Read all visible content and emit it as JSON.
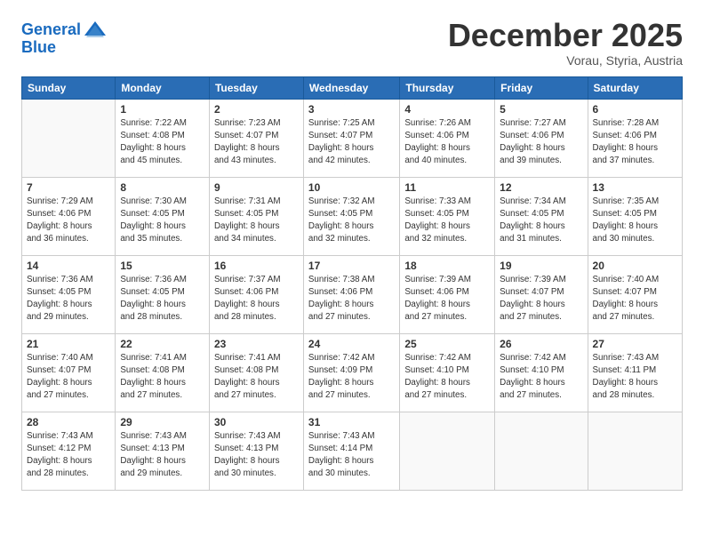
{
  "header": {
    "logo_general": "General",
    "logo_blue": "Blue",
    "month": "December 2025",
    "location": "Vorau, Styria, Austria"
  },
  "days_of_week": [
    "Sunday",
    "Monday",
    "Tuesday",
    "Wednesday",
    "Thursday",
    "Friday",
    "Saturday"
  ],
  "weeks": [
    [
      {
        "day": "",
        "info": ""
      },
      {
        "day": "1",
        "info": "Sunrise: 7:22 AM\nSunset: 4:08 PM\nDaylight: 8 hours\nand 45 minutes."
      },
      {
        "day": "2",
        "info": "Sunrise: 7:23 AM\nSunset: 4:07 PM\nDaylight: 8 hours\nand 43 minutes."
      },
      {
        "day": "3",
        "info": "Sunrise: 7:25 AM\nSunset: 4:07 PM\nDaylight: 8 hours\nand 42 minutes."
      },
      {
        "day": "4",
        "info": "Sunrise: 7:26 AM\nSunset: 4:06 PM\nDaylight: 8 hours\nand 40 minutes."
      },
      {
        "day": "5",
        "info": "Sunrise: 7:27 AM\nSunset: 4:06 PM\nDaylight: 8 hours\nand 39 minutes."
      },
      {
        "day": "6",
        "info": "Sunrise: 7:28 AM\nSunset: 4:06 PM\nDaylight: 8 hours\nand 37 minutes."
      }
    ],
    [
      {
        "day": "7",
        "info": "Sunrise: 7:29 AM\nSunset: 4:06 PM\nDaylight: 8 hours\nand 36 minutes."
      },
      {
        "day": "8",
        "info": "Sunrise: 7:30 AM\nSunset: 4:05 PM\nDaylight: 8 hours\nand 35 minutes."
      },
      {
        "day": "9",
        "info": "Sunrise: 7:31 AM\nSunset: 4:05 PM\nDaylight: 8 hours\nand 34 minutes."
      },
      {
        "day": "10",
        "info": "Sunrise: 7:32 AM\nSunset: 4:05 PM\nDaylight: 8 hours\nand 32 minutes."
      },
      {
        "day": "11",
        "info": "Sunrise: 7:33 AM\nSunset: 4:05 PM\nDaylight: 8 hours\nand 32 minutes."
      },
      {
        "day": "12",
        "info": "Sunrise: 7:34 AM\nSunset: 4:05 PM\nDaylight: 8 hours\nand 31 minutes."
      },
      {
        "day": "13",
        "info": "Sunrise: 7:35 AM\nSunset: 4:05 PM\nDaylight: 8 hours\nand 30 minutes."
      }
    ],
    [
      {
        "day": "14",
        "info": "Sunrise: 7:36 AM\nSunset: 4:05 PM\nDaylight: 8 hours\nand 29 minutes."
      },
      {
        "day": "15",
        "info": "Sunrise: 7:36 AM\nSunset: 4:05 PM\nDaylight: 8 hours\nand 28 minutes."
      },
      {
        "day": "16",
        "info": "Sunrise: 7:37 AM\nSunset: 4:06 PM\nDaylight: 8 hours\nand 28 minutes."
      },
      {
        "day": "17",
        "info": "Sunrise: 7:38 AM\nSunset: 4:06 PM\nDaylight: 8 hours\nand 27 minutes."
      },
      {
        "day": "18",
        "info": "Sunrise: 7:39 AM\nSunset: 4:06 PM\nDaylight: 8 hours\nand 27 minutes."
      },
      {
        "day": "19",
        "info": "Sunrise: 7:39 AM\nSunset: 4:07 PM\nDaylight: 8 hours\nand 27 minutes."
      },
      {
        "day": "20",
        "info": "Sunrise: 7:40 AM\nSunset: 4:07 PM\nDaylight: 8 hours\nand 27 minutes."
      }
    ],
    [
      {
        "day": "21",
        "info": "Sunrise: 7:40 AM\nSunset: 4:07 PM\nDaylight: 8 hours\nand 27 minutes."
      },
      {
        "day": "22",
        "info": "Sunrise: 7:41 AM\nSunset: 4:08 PM\nDaylight: 8 hours\nand 27 minutes."
      },
      {
        "day": "23",
        "info": "Sunrise: 7:41 AM\nSunset: 4:08 PM\nDaylight: 8 hours\nand 27 minutes."
      },
      {
        "day": "24",
        "info": "Sunrise: 7:42 AM\nSunset: 4:09 PM\nDaylight: 8 hours\nand 27 minutes."
      },
      {
        "day": "25",
        "info": "Sunrise: 7:42 AM\nSunset: 4:10 PM\nDaylight: 8 hours\nand 27 minutes."
      },
      {
        "day": "26",
        "info": "Sunrise: 7:42 AM\nSunset: 4:10 PM\nDaylight: 8 hours\nand 27 minutes."
      },
      {
        "day": "27",
        "info": "Sunrise: 7:43 AM\nSunset: 4:11 PM\nDaylight: 8 hours\nand 28 minutes."
      }
    ],
    [
      {
        "day": "28",
        "info": "Sunrise: 7:43 AM\nSunset: 4:12 PM\nDaylight: 8 hours\nand 28 minutes."
      },
      {
        "day": "29",
        "info": "Sunrise: 7:43 AM\nSunset: 4:13 PM\nDaylight: 8 hours\nand 29 minutes."
      },
      {
        "day": "30",
        "info": "Sunrise: 7:43 AM\nSunset: 4:13 PM\nDaylight: 8 hours\nand 30 minutes."
      },
      {
        "day": "31",
        "info": "Sunrise: 7:43 AM\nSunset: 4:14 PM\nDaylight: 8 hours\nand 30 minutes."
      },
      {
        "day": "",
        "info": ""
      },
      {
        "day": "",
        "info": ""
      },
      {
        "day": "",
        "info": ""
      }
    ]
  ]
}
